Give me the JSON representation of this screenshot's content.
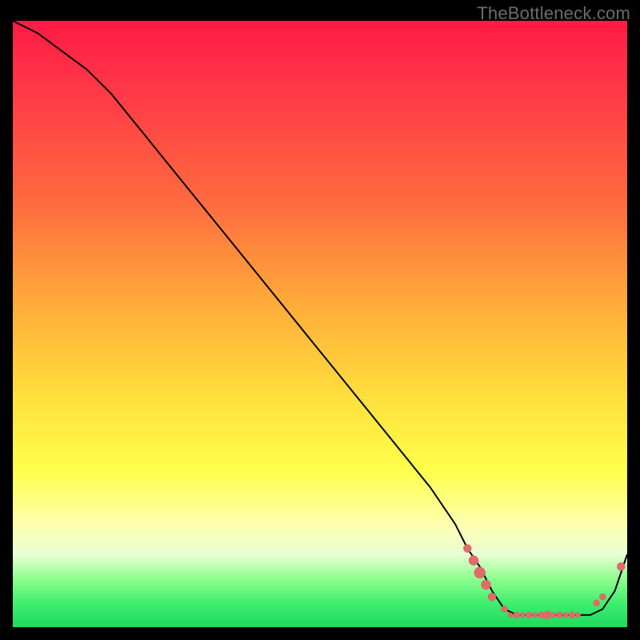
{
  "watermark": "TheBottleneck.com",
  "colors": {
    "curve_stroke": "#000000",
    "marker_fill": "#e36a6a",
    "marker_stroke": "#d85c5c"
  },
  "chart_data": {
    "type": "line",
    "title": "",
    "xlabel": "",
    "ylabel": "",
    "xlim": [
      0,
      100
    ],
    "ylim": [
      0,
      100
    ],
    "series": [
      {
        "name": "curve",
        "x": [
          0,
          4,
          8,
          12,
          16,
          20,
          24,
          28,
          32,
          36,
          40,
          44,
          48,
          52,
          56,
          60,
          64,
          68,
          72,
          74,
          76,
          78,
          80,
          82,
          84,
          86,
          88,
          90,
          92,
          94,
          96,
          98,
          100
        ],
        "y": [
          100,
          98,
          95,
          92,
          88,
          83,
          78,
          73,
          68,
          63,
          58,
          53,
          48,
          43,
          38,
          33,
          28,
          23,
          17,
          13,
          10,
          6,
          3,
          2,
          2,
          2,
          2,
          2,
          2,
          2,
          3,
          6,
          12
        ]
      }
    ],
    "markers": {
      "comment": "salmon dots along the flat valley and small upturn",
      "points": [
        {
          "x": 74,
          "y": 13,
          "r": 5
        },
        {
          "x": 75,
          "y": 11,
          "r": 6
        },
        {
          "x": 76,
          "y": 9,
          "r": 7
        },
        {
          "x": 77,
          "y": 7,
          "r": 6
        },
        {
          "x": 78,
          "y": 5,
          "r": 5
        },
        {
          "x": 80,
          "y": 3,
          "r": 4
        },
        {
          "x": 81,
          "y": 2,
          "r": 3
        },
        {
          "x": 82,
          "y": 2,
          "r": 4
        },
        {
          "x": 83,
          "y": 2,
          "r": 3
        },
        {
          "x": 84,
          "y": 2,
          "r": 4
        },
        {
          "x": 85,
          "y": 2,
          "r": 3
        },
        {
          "x": 86,
          "y": 2,
          "r": 4
        },
        {
          "x": 87,
          "y": 2,
          "r": 5
        },
        {
          "x": 88,
          "y": 2,
          "r": 3
        },
        {
          "x": 89,
          "y": 2,
          "r": 4
        },
        {
          "x": 90,
          "y": 2,
          "r": 3
        },
        {
          "x": 91,
          "y": 2,
          "r": 4
        },
        {
          "x": 92,
          "y": 2,
          "r": 3
        },
        {
          "x": 95,
          "y": 4,
          "r": 4
        },
        {
          "x": 96,
          "y": 5,
          "r": 4
        },
        {
          "x": 99,
          "y": 10,
          "r": 5
        }
      ]
    }
  }
}
